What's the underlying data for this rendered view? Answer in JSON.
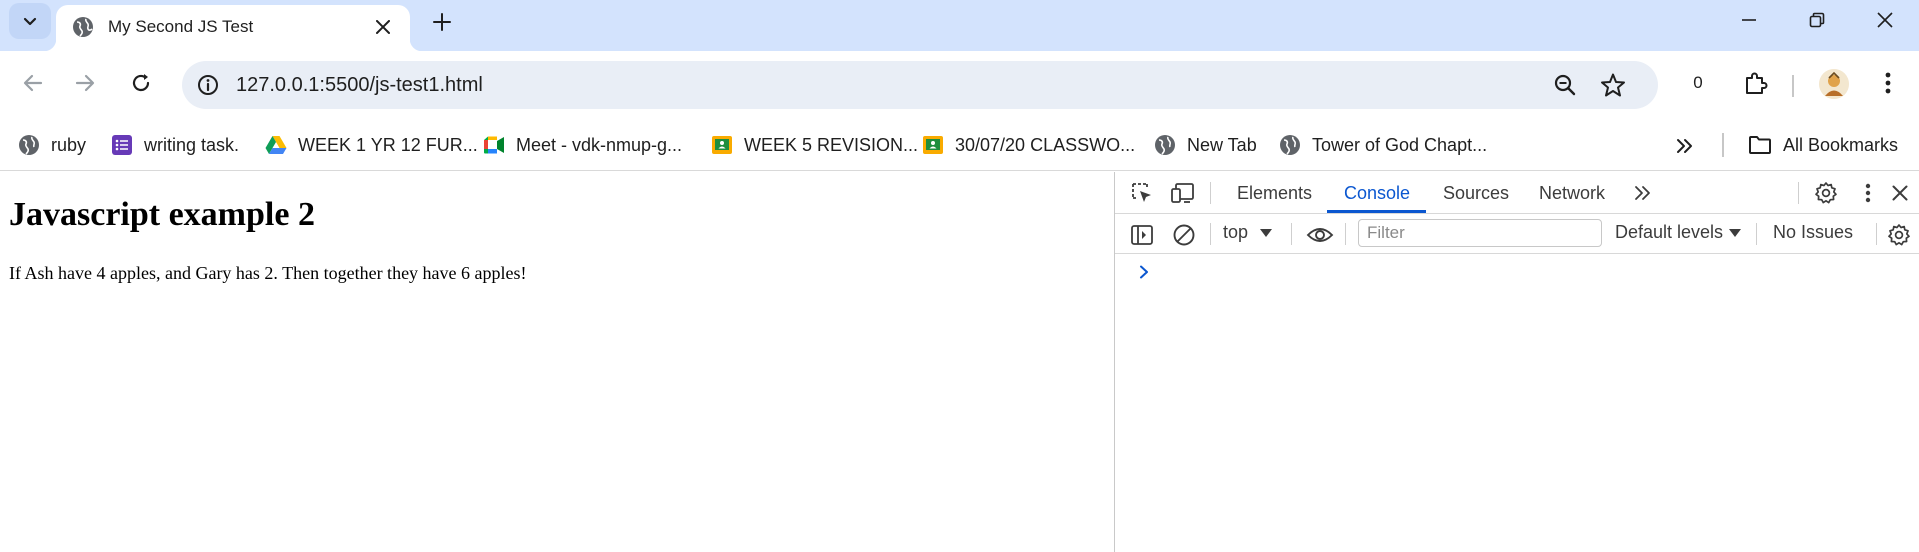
{
  "tab": {
    "title": "My Second JS Test"
  },
  "toolbar": {
    "url": "127.0.0.1:5500/js-test1.html",
    "extension_count": "0"
  },
  "bookmarks": {
    "items": [
      {
        "label": "ruby",
        "icon": "globe-icon"
      },
      {
        "label": "writing task.",
        "icon": "google-forms-icon"
      },
      {
        "label": "WEEK 1 YR 12 FUR...",
        "icon": "google-drive-icon"
      },
      {
        "label": "Meet - vdk-nmup-g...",
        "icon": "google-meet-icon"
      },
      {
        "label": "WEEK 5 REVISION...",
        "icon": "google-classroom-icon"
      },
      {
        "label": "30/07/20 CLASSWO...",
        "icon": "google-classroom-icon"
      },
      {
        "label": "New Tab",
        "icon": "globe-icon"
      },
      {
        "label": "Tower of God Chapt...",
        "icon": "globe-icon"
      }
    ],
    "all_bookmarks_label": "All Bookmarks"
  },
  "page": {
    "heading": "Javascript example 2",
    "paragraph": "If Ash have 4 apples, and Gary has 2. Then together they have 6 apples!"
  },
  "devtools": {
    "tabs": [
      {
        "label": "Elements"
      },
      {
        "label": "Console",
        "active": true
      },
      {
        "label": "Sources"
      },
      {
        "label": "Network"
      }
    ],
    "context": "top",
    "filter_placeholder": "Filter",
    "levels": "Default levels",
    "issues": "No Issues"
  },
  "colors": {
    "tabstrip_bg": "#d3e3fd",
    "omnibox_bg": "#e9eef6",
    "accent_blue": "#0b57d0"
  }
}
